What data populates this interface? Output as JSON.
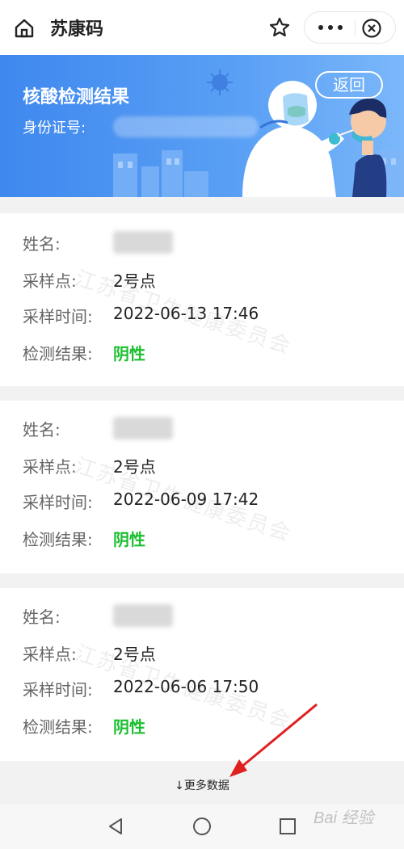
{
  "header": {
    "title": "苏康码"
  },
  "banner": {
    "title": "核酸检测结果",
    "id_label": "身份证号:",
    "back_label": "返回"
  },
  "labels": {
    "name": "姓名:",
    "site": "采样点:",
    "time": "采样时间:",
    "result": "检测结果:"
  },
  "watermark": "江苏省卫生健康委员会",
  "records": [
    {
      "site": "2号点",
      "time": "2022-06-13 17:46",
      "result": "阴性"
    },
    {
      "site": "2号点",
      "time": "2022-06-09 17:42",
      "result": "阴性"
    },
    {
      "site": "2号点",
      "time": "2022-06-06 17:50",
      "result": "阴性"
    }
  ],
  "more_data": "↓更多数据",
  "colors": {
    "banner": "#4a90f0",
    "negative": "#1bbf2f"
  },
  "footer_watermark": "Bai 经验"
}
